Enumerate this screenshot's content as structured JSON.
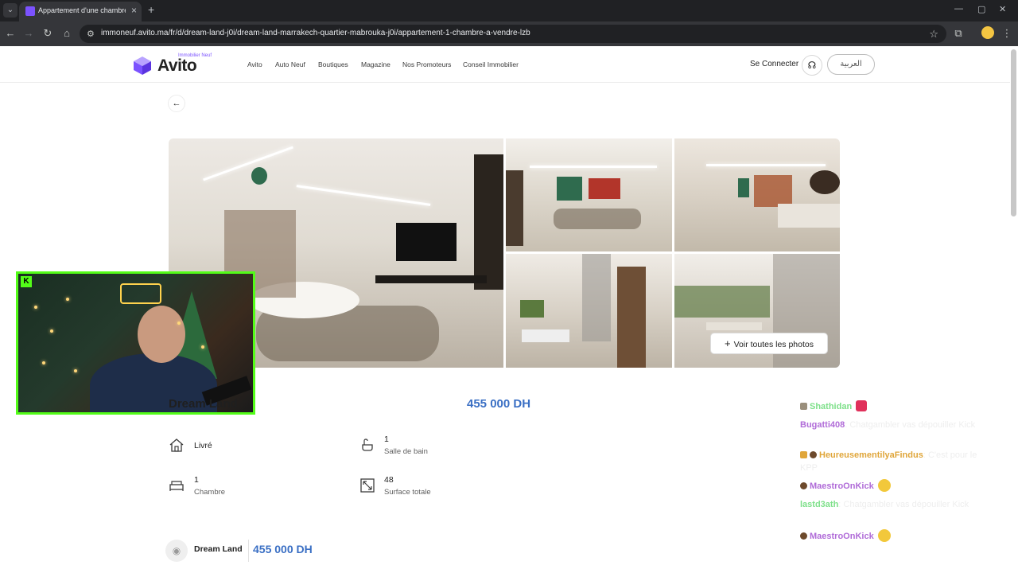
{
  "browser": {
    "tab_title": "Appartement d'une chambre s...",
    "url": "immoneuf.avito.ma/fr/d/dream-land-j0i/dream-land-marrakech-quartier-mabrouka-j0i/appartement-1-chambre-a-vendre-lzb"
  },
  "header": {
    "logo_small": "Immobilier Neuf",
    "logo": "Avito",
    "nav": [
      "Avito",
      "Auto Neuf",
      "Boutiques",
      "Magazine",
      "Nos Promoteurs",
      "Conseil Immobilier"
    ],
    "connect": "Se Connecter",
    "language": "العربية"
  },
  "gallery": {
    "see_all": "Voir toutes les photos"
  },
  "listing": {
    "title": "Dream Land",
    "price": "455 000 DH",
    "features": [
      {
        "icon": "house-icon",
        "value": "Livré",
        "label": ""
      },
      {
        "icon": "bath-icon",
        "value": "1",
        "label": "Salle de bain"
      },
      {
        "icon": "bed-icon",
        "value": "1",
        "label": "Chambre"
      },
      {
        "icon": "area-icon",
        "value": "48",
        "label": "Surface totale"
      }
    ]
  },
  "sticky_bar": {
    "title": "Dream Land",
    "price": "455 000 DH"
  },
  "stream": {
    "platform_badge": "K",
    "chat": [
      {
        "user": "Shathidan",
        "message": "",
        "user_color": "#7ee08a",
        "emote": "red"
      },
      {
        "user": "Bugatti408",
        "message": ": Chatgambler vas dépouiller Kick",
        "user_color": "#b06bd8",
        "emote": ""
      },
      {
        "user": "HeureusementilyaFindus",
        "message": ": C'est pour le KPP",
        "user_color": "#e0a63a",
        "emote": ""
      },
      {
        "user": "MaestroOnKick",
        "message": "",
        "user_color": "#b06bd8",
        "emote": "smile"
      },
      {
        "user": "lastd3ath",
        "message": ": Chatgambler vas dépouiller Kick",
        "user_color": "#7ee08a",
        "emote": ""
      },
      {
        "user": "MaestroOnKick",
        "message": "",
        "user_color": "#b06bd8",
        "emote": "smile"
      }
    ]
  },
  "colors": {
    "accent": "#7b52ff",
    "price": "#3a6fc4",
    "kick_green": "#53fc18"
  }
}
